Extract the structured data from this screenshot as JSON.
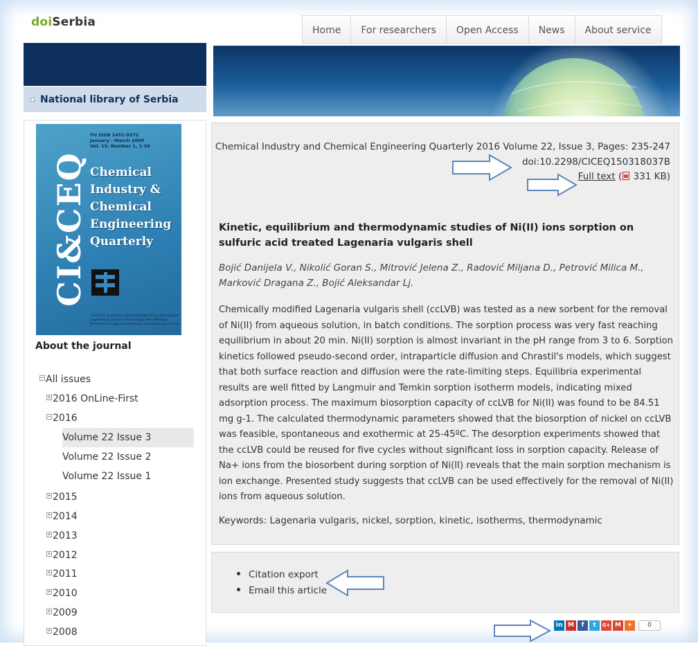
{
  "header": {
    "logo_doi": "doi",
    "logo_serbia": "Serbia",
    "nav": [
      "Home",
      "For researchers",
      "Open Access",
      "News",
      "About service"
    ]
  },
  "left_panel": {
    "library_label": "National library of Serbia",
    "cover": {
      "meta_lines": [
        "YU ISSN 1451-9372",
        "January - March 2009",
        "Vol. 15, Number 1, 1-56"
      ],
      "vertical_text": "CI&CEQ",
      "title_lines": [
        "Chemical",
        "Industry &",
        "Chemical",
        "Engineering",
        "Quarterly"
      ],
      "footer": "The ACHE Journal for Chemical Engineering, Biochemical Engineering, Chemical Technology, New Materials, Renewable Energy and Chemistry www.ache.org.rs/ciceq"
    },
    "about_label": "About the journal",
    "tree": [
      {
        "label": "All issues",
        "icon": "minus"
      },
      {
        "label": "2016 OnLine-First",
        "icon": "plus"
      },
      {
        "label": "2016",
        "icon": "minus"
      },
      {
        "label": "Volume 22 Issue 3",
        "icon": "",
        "selected": true
      },
      {
        "label": "Volume 22 Issue 2",
        "icon": ""
      },
      {
        "label": "Volume 22 Issue 1",
        "icon": ""
      },
      {
        "label": "2015",
        "icon": "plus"
      },
      {
        "label": "2014",
        "icon": "plus"
      },
      {
        "label": "2013",
        "icon": "plus"
      },
      {
        "label": "2012",
        "icon": "plus"
      },
      {
        "label": "2011",
        "icon": "plus"
      },
      {
        "label": "2010",
        "icon": "plus"
      },
      {
        "label": "2009",
        "icon": "plus"
      },
      {
        "label": "2008",
        "icon": "plus"
      }
    ]
  },
  "article": {
    "citation": "Chemical Industry and Chemical Engineering Quarterly 2016 Volume 22, Issue 3, Pages: 235-247",
    "doi": "doi:10.2298/CICEQ150318037B",
    "fulltext_label": "Full text",
    "fulltext_size_prefix": " (",
    "fulltext_size": " 331 KB)",
    "title": "Kinetic, equilibrium and thermodynamic studies of Ni(II) ions sorption on sulfuric acid treated Lagenaria vulgaris shell",
    "authors": "Bojić Danijela V., Nikolić Goran S., Mitrović Jelena Z., Radović Miljana D., Petrović Milica M., Marković Dragana Z., Bojić Aleksandar Lj.",
    "abstract": "Chemically modified Lagenaria vulgaris shell (ccLVB) was tested as a new sorbent for the removal of Ni(II) from aqueous solution, in batch conditions. The sorption process was very fast reaching equilibrium in about 20 min. Ni(II) sorption is almost invariant in the pH range from 3 to 6. Sorption kinetics followed pseudo-second order, intraparticle diffusion and Chrastil's models, which suggest that both surface reaction and diffusion were the rate-limiting steps. Equilibria experimental results are well fitted by Langmuir and Temkin sorption isotherm models, indicating mixed adsorption process. The maximum biosorption capacity of ccLVB for Ni(II) was found to be 84.51 mg g-1. The calculated thermodynamic parameters showed that the biosorption of nickel on ccLVB was feasible, spontaneous and exothermic at 25-45ºC. The desorption experiments showed that the ccLVB could be reused for five cycles without significant loss in sorption capacity. Release of Na+ ions from the biosorbent during sorption of Ni(II) reveals that the main sorption mechanism is ion exchange. Presented study suggests that ccLVB can be used effectively for the removal of Ni(II) ions from aqueous solution.",
    "keywords": "Keywords: Lagenaria vulgaris, nickel, sorption, kinetic, isotherms, thermodynamic"
  },
  "actions": [
    "Citation export",
    "Email this article"
  ],
  "share": {
    "buttons": [
      {
        "label": "in",
        "icon": "linkedin-icon",
        "color": "#0077b5"
      },
      {
        "label": "M",
        "icon": "mendeley-icon",
        "color": "#c8312f"
      },
      {
        "label": "f",
        "icon": "facebook-icon",
        "color": "#3b5998"
      },
      {
        "label": "t",
        "icon": "twitter-icon",
        "color": "#29a9e0"
      },
      {
        "label": "G+",
        "icon": "googleplus-icon",
        "color": "#dd4b39"
      },
      {
        "label": "M",
        "icon": "gmail-icon",
        "color": "#d14836"
      },
      {
        "label": "+",
        "icon": "addthis-icon",
        "color": "#f36f24"
      }
    ],
    "count": "0"
  },
  "colors": {
    "logo_green": "#7aa91f",
    "navy": "#0d2f5e",
    "arrow": "#4f7cb0"
  }
}
